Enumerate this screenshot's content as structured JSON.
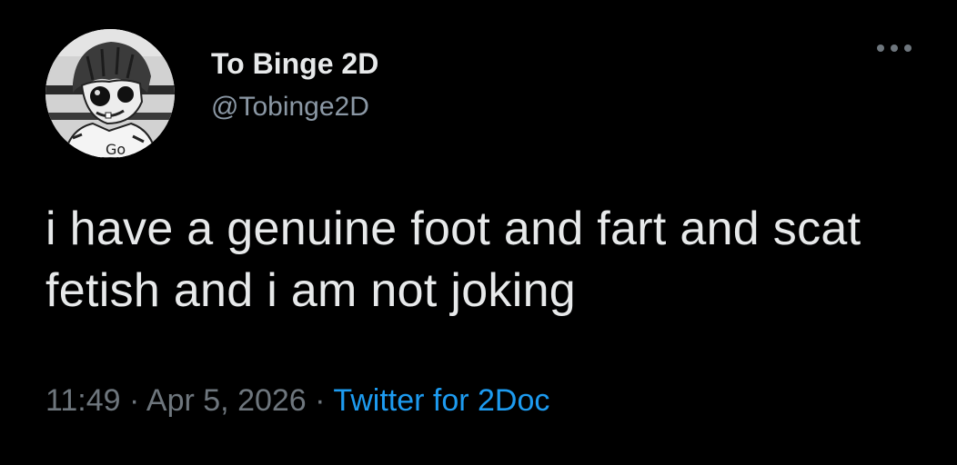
{
  "author": {
    "display_name": "To Binge 2D",
    "handle": "@Tobinge2D",
    "avatar_icon": "cartoon-character-avatar"
  },
  "menu": {
    "icon": "more-options-icon"
  },
  "tweet": {
    "text": "i have a genuine foot and fart and scat fetish and i am not joking"
  },
  "meta": {
    "time": "11:49",
    "separator_1": " · ",
    "date": "Apr 5, 2026",
    "separator_2": " · ",
    "source": "Twitter for 2Doc"
  },
  "colors": {
    "background": "#000000",
    "primary_text": "#e7e9ea",
    "secondary_text": "#6e767d",
    "link": "#1d9bf0"
  }
}
